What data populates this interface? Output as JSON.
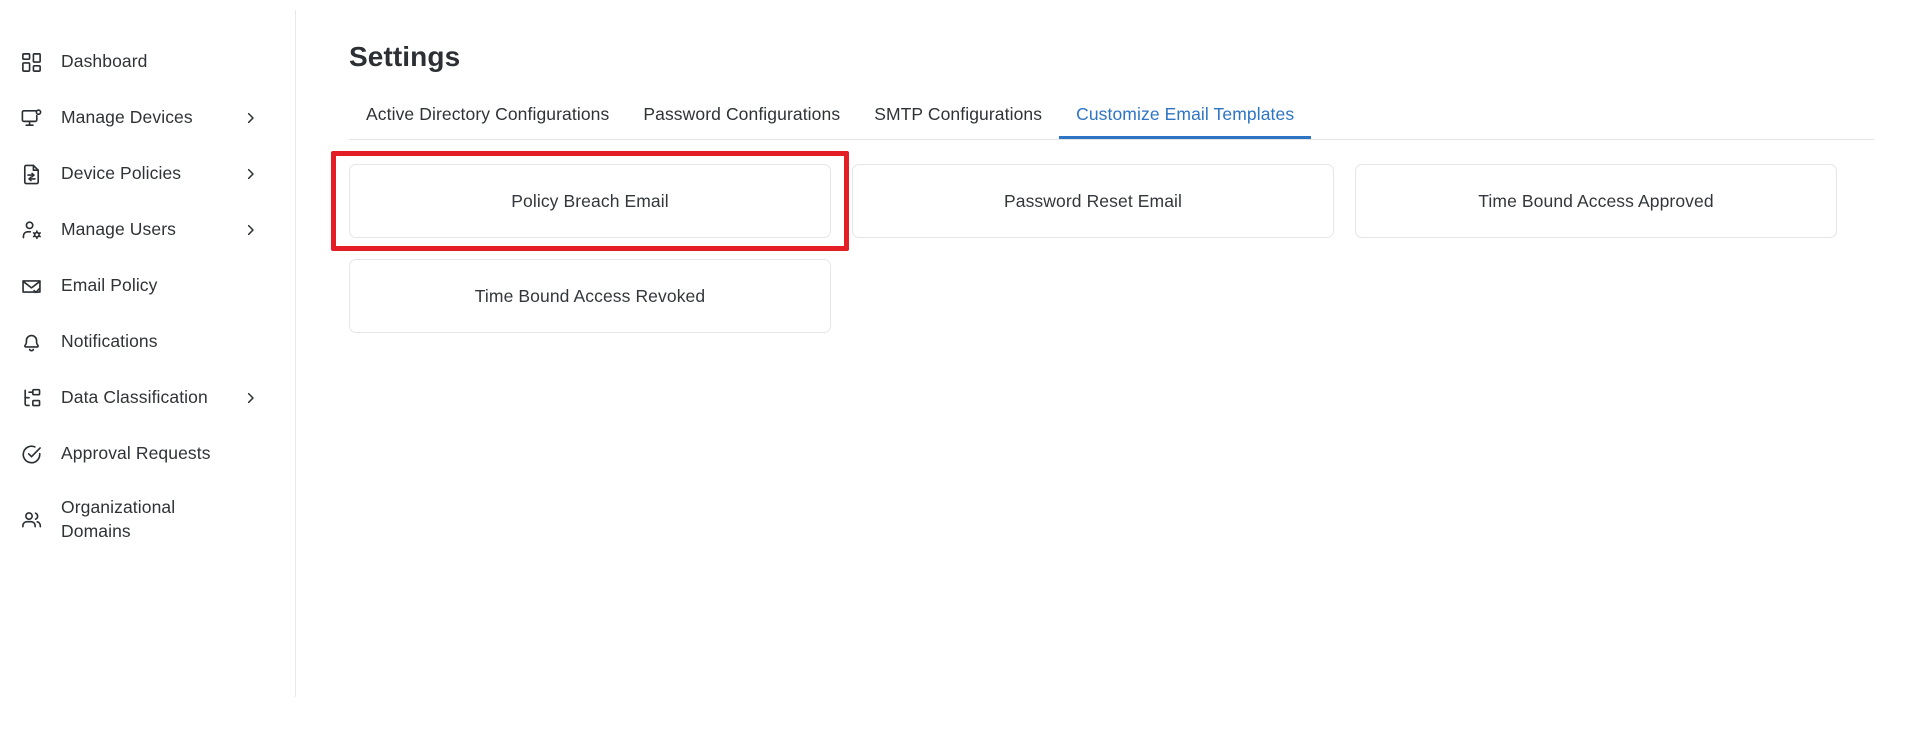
{
  "sidebar": {
    "items": [
      {
        "label": "Dashboard",
        "icon": "dashboard-grid-icon",
        "has_chevron": false,
        "multiline": false
      },
      {
        "label": "Manage Devices",
        "icon": "monitor-device-icon",
        "has_chevron": true,
        "multiline": false
      },
      {
        "label": "Device Policies",
        "icon": "document-policy-icon",
        "has_chevron": true,
        "multiline": false
      },
      {
        "label": "Manage Users",
        "icon": "user-gear-icon",
        "has_chevron": true,
        "multiline": false
      },
      {
        "label": "Email Policy",
        "icon": "envelope-check-icon",
        "has_chevron": false,
        "multiline": false
      },
      {
        "label": "Notifications",
        "icon": "bell-icon",
        "has_chevron": false,
        "multiline": false
      },
      {
        "label": "Data Classification",
        "icon": "hierarchy-tree-icon",
        "has_chevron": true,
        "multiline": false
      },
      {
        "label": "Approval Requests",
        "icon": "check-circle-icon",
        "has_chevron": false,
        "multiline": false
      },
      {
        "label": "Organizational\nDomains",
        "icon": "users-group-icon",
        "has_chevron": false,
        "multiline": true
      }
    ]
  },
  "main": {
    "title": "Settings",
    "tabs": [
      {
        "label": "Active Directory Configurations",
        "active": false
      },
      {
        "label": "Password Configurations",
        "active": false
      },
      {
        "label": "SMTP Configurations",
        "active": false
      },
      {
        "label": "Customize Email Templates",
        "active": true
      }
    ],
    "template_cards": [
      {
        "label": "Policy Breach Email",
        "highlighted": true
      },
      {
        "label": "Password Reset Email",
        "highlighted": false
      },
      {
        "label": "Time Bound Access Approved",
        "highlighted": false
      },
      {
        "label": "Time Bound Access Revoked",
        "highlighted": false
      }
    ]
  },
  "colors": {
    "accent": "#2d75c4",
    "highlight": "#e31e24",
    "text": "#2f3337",
    "border": "#e6e6e6",
    "background": "#ffffff"
  }
}
